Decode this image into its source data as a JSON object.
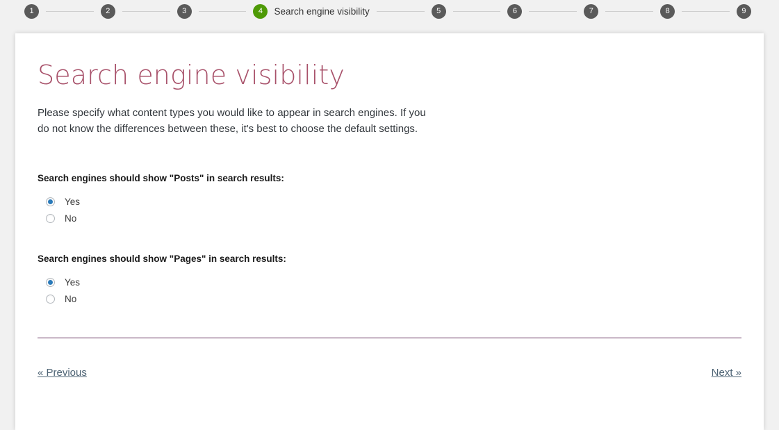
{
  "colors": {
    "background": "#f1f1f1",
    "card": "#ffffff",
    "title": "#a8516a",
    "step_inactive": "#5a5a5a",
    "step_active": "#4e9a06",
    "divider": "#63305c",
    "link": "#4d6374",
    "radio_dot": "#2a7ab9"
  },
  "stepper": {
    "steps": [
      {
        "number": "1",
        "label": "",
        "active": false
      },
      {
        "number": "2",
        "label": "",
        "active": false
      },
      {
        "number": "3",
        "label": "",
        "active": false
      },
      {
        "number": "4",
        "label": "Search engine visibility",
        "active": true
      },
      {
        "number": "5",
        "label": "",
        "active": false
      },
      {
        "number": "6",
        "label": "",
        "active": false
      },
      {
        "number": "7",
        "label": "",
        "active": false
      },
      {
        "number": "8",
        "label": "",
        "active": false
      },
      {
        "number": "9",
        "label": "",
        "active": false
      }
    ]
  },
  "page": {
    "title": "Search engine visibility",
    "intro": "Please specify what content types you would like to appear in search engines. If you do not know the differences between these, it's best to choose the default settings."
  },
  "questions": [
    {
      "label": "Search engines should show \"Posts\" in search results:",
      "options": [
        {
          "label": "Yes",
          "checked": true
        },
        {
          "label": "No",
          "checked": false
        }
      ]
    },
    {
      "label": "Search engines should show \"Pages\" in search results:",
      "options": [
        {
          "label": "Yes",
          "checked": true
        },
        {
          "label": "No",
          "checked": false
        }
      ]
    }
  ],
  "navigation": {
    "previous_label": "« Previous",
    "next_label": "Next »"
  }
}
